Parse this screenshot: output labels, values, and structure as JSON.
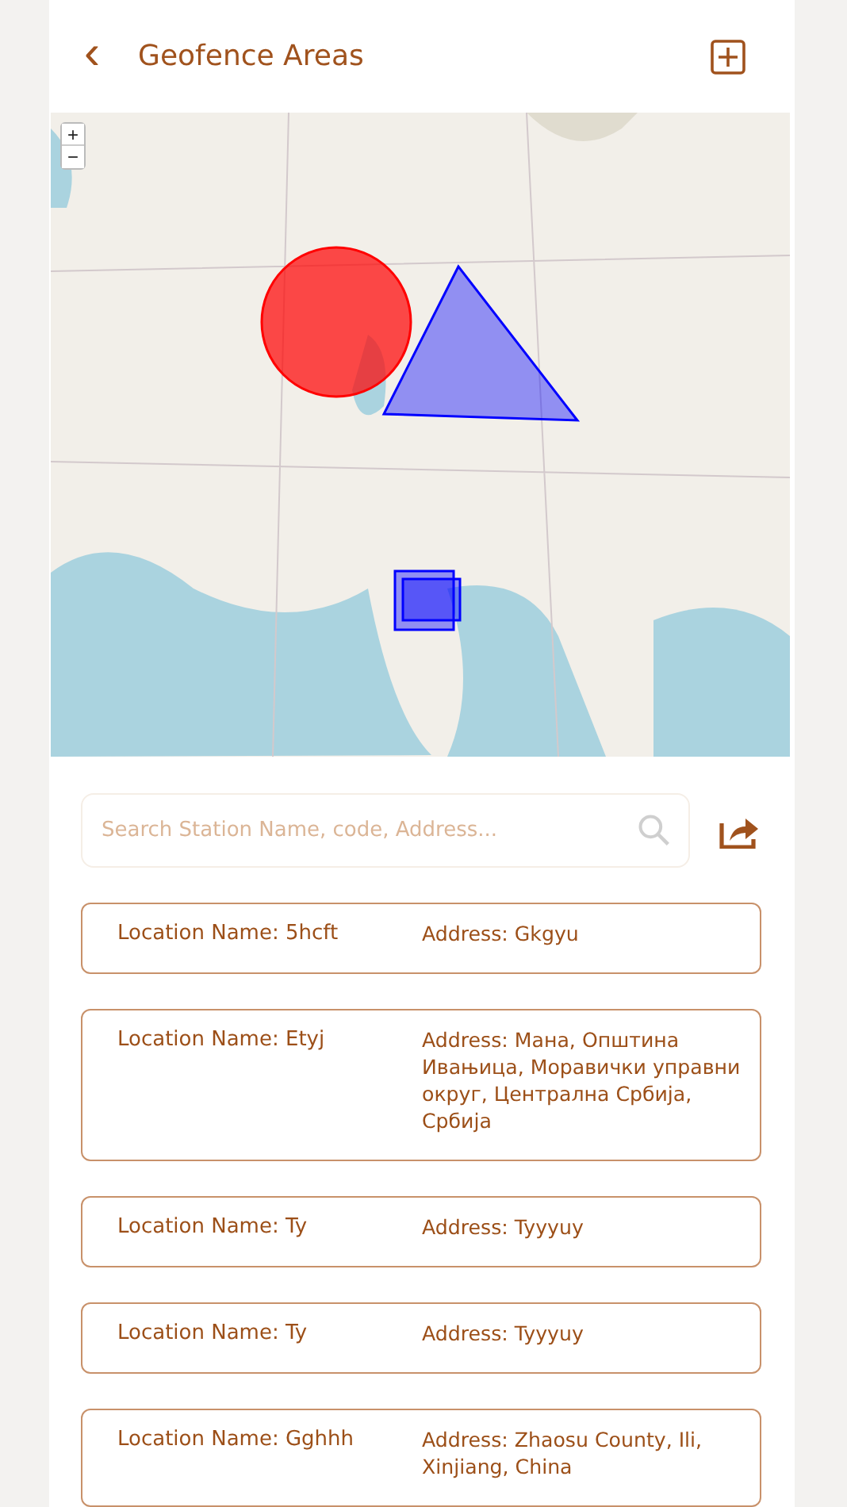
{
  "header": {
    "back": "‹",
    "title": "Geofence Areas"
  },
  "map": {
    "zoom_in": "+",
    "zoom_out": "−",
    "geofences": [
      {
        "kind": "circle",
        "color": "#ff0000"
      },
      {
        "kind": "triangle",
        "color": "#0000ff"
      },
      {
        "kind": "rectangle",
        "color": "#0000ff"
      },
      {
        "kind": "rectangle",
        "color": "#0000ff"
      }
    ]
  },
  "search": {
    "placeholder": "Search Station Name, code, Address..."
  },
  "locations": [
    {
      "name": "Location Name: 5hcft",
      "address": "Address: Gkgyu"
    },
    {
      "name": "Location Name: Etyj",
      "address": "Address: Мана, Општина Ивањица, Моравички управни округ, Централна Србија, Србија"
    },
    {
      "name": "Location Name: Ty",
      "address": "Address: Tyyyuy"
    },
    {
      "name": "Location Name: Ty",
      "address": "Address: Tyyyuy"
    },
    {
      "name": "Location Name: Gghhh",
      "address": "Address: Zhaosu County, Ili, Xinjiang, China"
    }
  ]
}
